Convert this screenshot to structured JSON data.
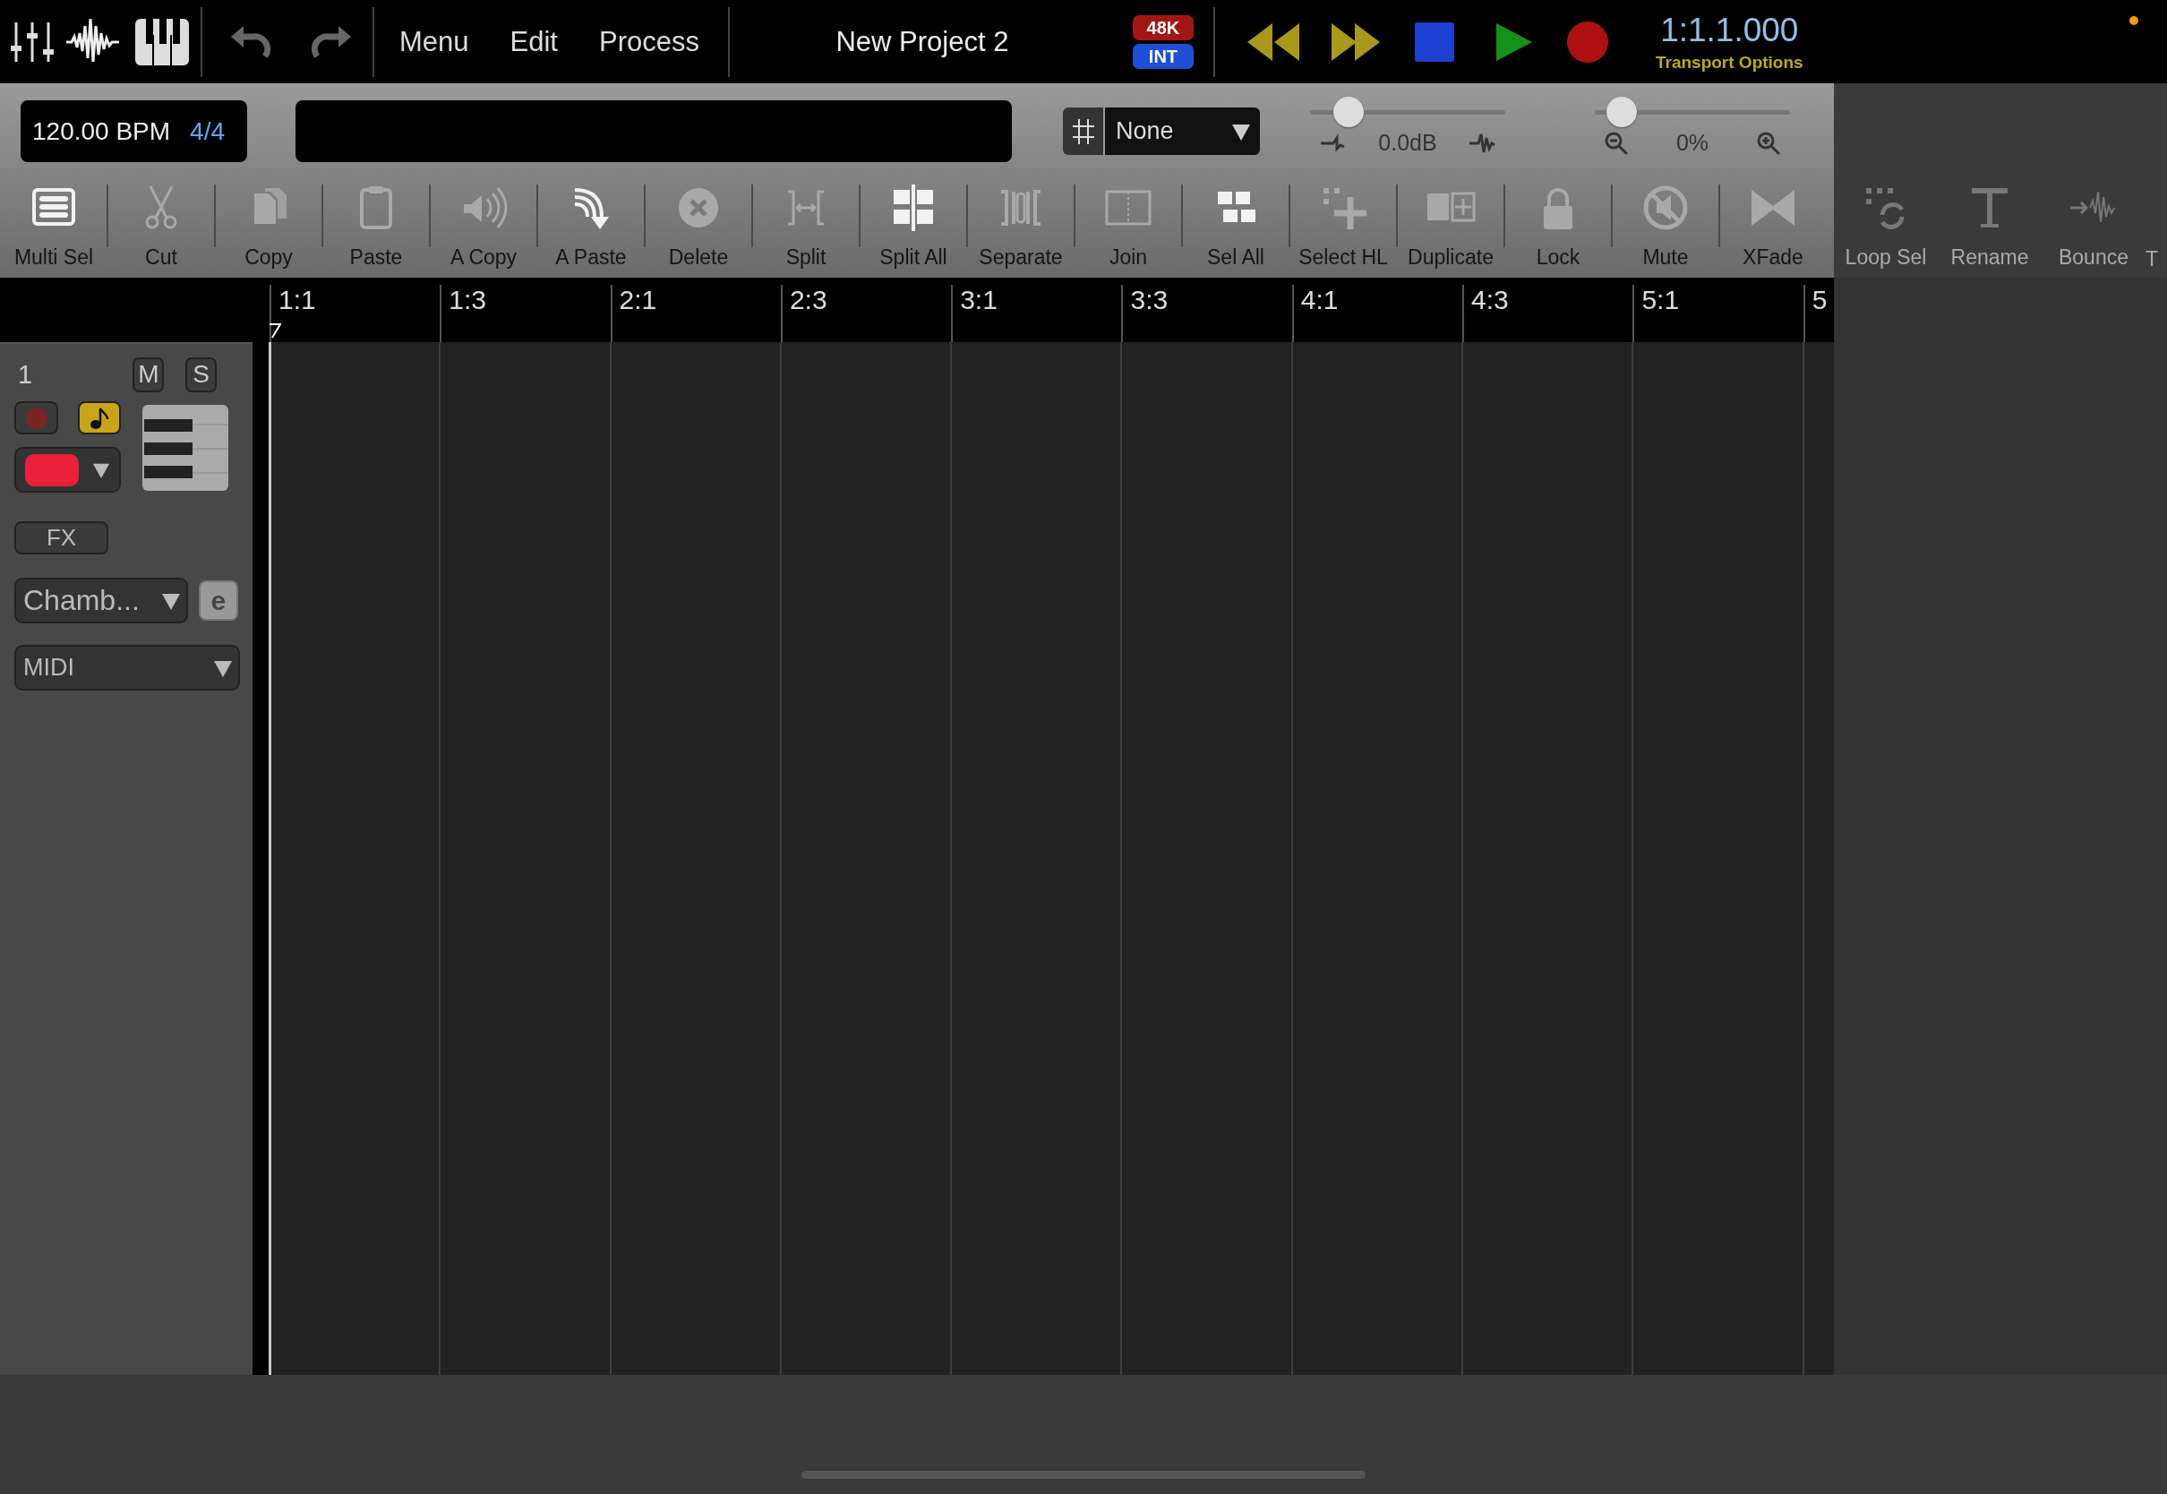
{
  "top_bar": {
    "menus": [
      {
        "label": "Menu"
      },
      {
        "label": "Edit"
      },
      {
        "label": "Process"
      }
    ],
    "title": "New Project 2",
    "sample_rate": "48K",
    "clock": "INT",
    "time": "1:1.1.000",
    "transport_options": "Transport Options"
  },
  "tempo": {
    "bpm": "120.00 BPM",
    "meter": "4/4"
  },
  "snap": {
    "value": "None"
  },
  "volume": {
    "level": 0.14,
    "reading": "0.0dB"
  },
  "zoom": {
    "level": 0.07,
    "reading": "0%"
  },
  "tools": [
    {
      "label": "Multi Sel",
      "enabled": true
    },
    {
      "label": "Cut",
      "enabled": false
    },
    {
      "label": "Copy",
      "enabled": false
    },
    {
      "label": "Paste",
      "enabled": false
    },
    {
      "label": "A Copy",
      "enabled": false
    },
    {
      "label": "A Paste",
      "enabled": true
    },
    {
      "label": "Delete",
      "enabled": false
    },
    {
      "label": "Split",
      "enabled": false
    },
    {
      "label": "Split All",
      "enabled": true
    },
    {
      "label": "Separate",
      "enabled": false
    },
    {
      "label": "Join",
      "enabled": false
    },
    {
      "label": "Sel All",
      "enabled": true
    },
    {
      "label": "Select HL",
      "enabled": false
    },
    {
      "label": "Duplicate",
      "enabled": false
    },
    {
      "label": "Lock",
      "enabled": false
    },
    {
      "label": "Mute",
      "enabled": false
    },
    {
      "label": "XFade",
      "enabled": false
    },
    {
      "label": "Loop Sel",
      "enabled": false
    },
    {
      "label": "Rename",
      "enabled": false
    },
    {
      "label": "Bounce",
      "enabled": false
    },
    {
      "label": "T"
    }
  ],
  "ruler": {
    "marks": [
      "1:1",
      "1:3",
      "2:1",
      "2:3",
      "3:1",
      "3:3",
      "4:1",
      "4:3",
      "5:1",
      "5"
    ]
  },
  "track": {
    "number": "1",
    "mute": {
      "label": "M",
      "on": false
    },
    "solo": {
      "label": "S",
      "on": false
    },
    "armed": false,
    "midi_thru": true,
    "color": "#e8203a",
    "fx": "FX",
    "instrument": "Chamb...",
    "edit": "e",
    "input": "MIDI"
  }
}
